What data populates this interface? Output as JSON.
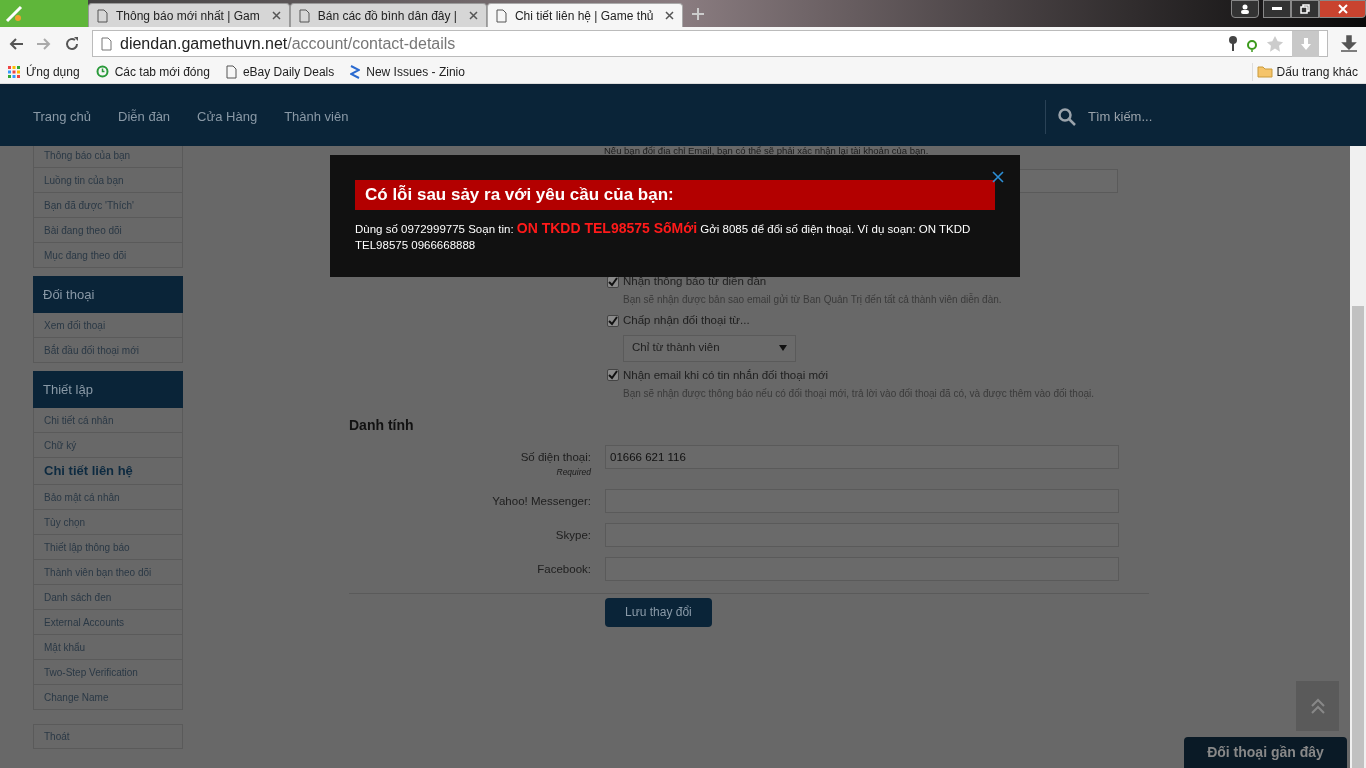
{
  "browser": {
    "tabs": [
      {
        "title": "Thông báo mới nhất | Gam",
        "selected": false
      },
      {
        "title": "Bán các đồ bình dân đây |",
        "selected": false
      },
      {
        "title": "Chi tiết liên hệ | Game thủ",
        "selected": true
      }
    ],
    "url": {
      "host": "diendan.gamethuvn.net",
      "path": "/account/contact-details"
    },
    "bookmarks": [
      "Ứng dụng",
      "Các tab mới đóng",
      "eBay Daily Deals",
      "New Issues - Zinio"
    ],
    "other_bookmarks": "Dấu trang khác"
  },
  "nav": {
    "items": [
      "Trang chủ",
      "Diễn đàn",
      "Cửa Hàng",
      "Thành viên"
    ],
    "search_placeholder": "Tìm kiếm..."
  },
  "sidebar": {
    "sections": [
      {
        "items": [
          {
            "label": "Thông báo của bạn",
            "selected": false
          },
          {
            "label": "Luồng tin của bạn",
            "selected": false
          },
          {
            "label": "Bạn đã được 'Thích'",
            "selected": false
          },
          {
            "label": "Bài đang theo dõi",
            "selected": false
          },
          {
            "label": "Mục đang theo dõi",
            "selected": false
          }
        ]
      },
      {
        "title": "Đối thoại",
        "items": [
          {
            "label": "Xem đối thoại",
            "selected": false
          },
          {
            "label": "Bắt đầu đối thoại mới",
            "selected": false
          }
        ]
      },
      {
        "title": "Thiết lập",
        "items": [
          {
            "label": "Chi tiết cá nhân",
            "selected": false
          },
          {
            "label": "Chữ ký",
            "selected": false
          },
          {
            "label": "Chi tiết liên hệ",
            "selected": true
          },
          {
            "label": "Bảo mật cá nhân",
            "selected": false
          },
          {
            "label": "Tùy chọn",
            "selected": false
          },
          {
            "label": "Thiết lập thông báo",
            "selected": false
          },
          {
            "label": "Thành viên bạn theo dõi",
            "selected": false
          },
          {
            "label": "Danh sách đen",
            "selected": false
          },
          {
            "label": "External Accounts",
            "selected": false
          },
          {
            "label": "Mật khẩu",
            "selected": false
          },
          {
            "label": "Two-Step Verification",
            "selected": false
          },
          {
            "label": "Change Name",
            "selected": false
          }
        ]
      },
      {
        "items": [
          {
            "label": "Thoát",
            "selected": false
          }
        ]
      }
    ]
  },
  "form": {
    "email_hint": "Nếu bạn đổi địa chỉ Email, bạn có thể sẽ phải xác nhận lại tài khoản của bạn.",
    "options": [
      {
        "kind": "checkbox",
        "label": "Nhận thông báo từ diễn đàn",
        "checked": true,
        "hint": "Bạn sẽ nhận được bản sao email gửi từ Ban Quản Trị đến tất cả thành viên diễn đàn."
      },
      {
        "kind": "checkbox",
        "label": "Chấp nhận đối thoại từ...",
        "checked": true
      },
      {
        "kind": "select",
        "value": "Chỉ từ thành viên"
      },
      {
        "kind": "checkbox",
        "label": "Nhận email khi có tin nhắn đối thoại mới",
        "checked": true,
        "hint": "Bạn sẽ nhận được thông báo nếu có đối thoại mới, trả lời vào đối thoại đã có, và được thêm vào đối thoại."
      }
    ],
    "identity": {
      "title": "Danh tính",
      "fields": [
        {
          "label": "Số điện thoại:",
          "note": "Required",
          "value": "01666 621 116"
        },
        {
          "label": "Yahoo! Messenger:"
        },
        {
          "label": "Skype:"
        },
        {
          "label": "Facebook:"
        }
      ],
      "save": "Lưu thay đổi"
    }
  },
  "modal": {
    "title": "Có lỗi sau sảy ra với yêu cầu của bạn:",
    "message": "Dùng số 0972999775 Soạn tin: **ON TKDD TEL98575 SốMới** Gởi 8085 để đổi số điện thoại. Ví dụ soạn: ON TKDD TEL98575 0966668888"
  },
  "recent_conversations": "Đối thoại gần đây"
}
